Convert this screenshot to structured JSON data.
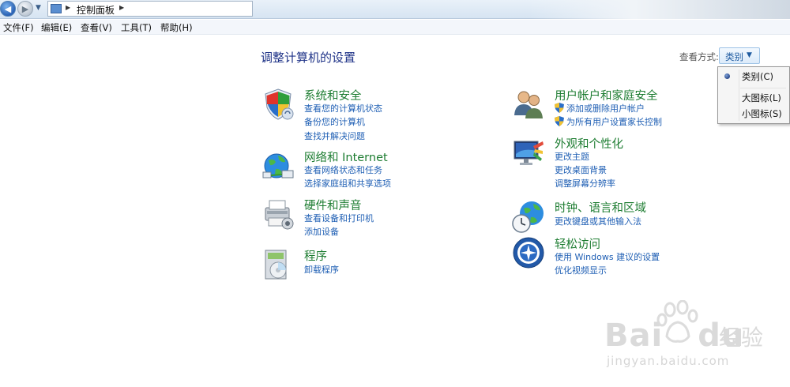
{
  "address": {
    "breadcrumb": "控制面板"
  },
  "menubar": {
    "items": [
      "文件(F)",
      "编辑(E)",
      "查看(V)",
      "工具(T)",
      "帮助(H)"
    ]
  },
  "main": {
    "title": "调整计算机的设置",
    "view_by_label": "查看方式:",
    "view_by_value": "类别"
  },
  "view_menu": {
    "options": [
      "类别(C)",
      "大图标(L)",
      "小图标(S)"
    ],
    "selected_index": 0
  },
  "categories_left": [
    {
      "title": "系统和安全",
      "links": [
        "查看您的计算机状态",
        "备份您的计算机",
        "查找并解决问题"
      ]
    },
    {
      "title": "网络和 Internet",
      "links": [
        "查看网络状态和任务",
        "选择家庭组和共享选项"
      ]
    },
    {
      "title": "硬件和声音",
      "links": [
        "查看设备和打印机",
        "添加设备"
      ]
    },
    {
      "title": "程序",
      "links": [
        "卸载程序"
      ]
    }
  ],
  "categories_right": [
    {
      "title": "用户帐户和家庭安全",
      "links": [
        "添加或删除用户帐户",
        "为所有用户设置家长控制"
      ]
    },
    {
      "title": "外观和个性化",
      "links": [
        "更改主题",
        "更改桌面背景",
        "调整屏幕分辨率"
      ]
    },
    {
      "title": "时钟、语言和区域",
      "links": [
        "更改键盘或其他输入法"
      ]
    },
    {
      "title": "轻松访问",
      "links": [
        "使用 Windows 建议的设置",
        "优化视频显示"
      ]
    }
  ],
  "watermark": {
    "brand": "Bai",
    "brand2": "du",
    "cn": "经验",
    "url": "jingyan.baidu.com"
  },
  "colors": {
    "title_blue": "#1e3287",
    "category_green": "#1e7d32",
    "link_blue": "#1f5fb4"
  }
}
